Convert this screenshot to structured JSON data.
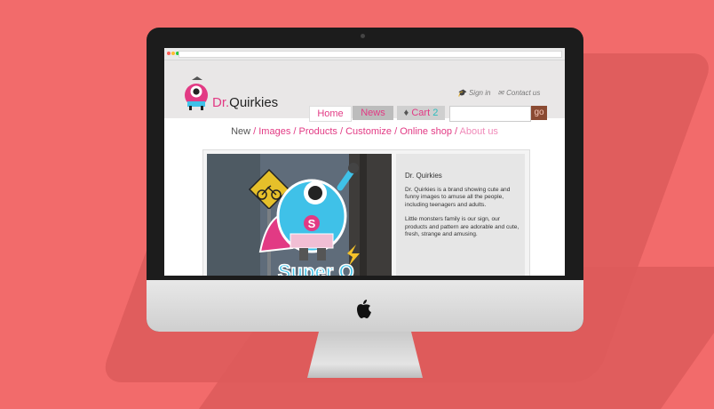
{
  "site": {
    "brand_prefix": "Dr.",
    "brand_name": "Quirkies",
    "top_links": {
      "sign_in": "Sign in",
      "contact": "Contact us"
    },
    "nav": {
      "home": "Home",
      "news": "News",
      "cart_label": "Cart",
      "cart_count": "2"
    },
    "search": {
      "placeholder": "",
      "button": "go"
    },
    "menu": [
      {
        "label": "New"
      },
      {
        "label": "Images"
      },
      {
        "label": "Products"
      },
      {
        "label": "Customize"
      },
      {
        "label": "Online shop"
      },
      {
        "label": "About us"
      }
    ],
    "feature": {
      "title": "Dr. Quirkies",
      "paragraph1": "Dr. Quirkies is a brand showing cute and funny images to amuse all the people, including teenagers and adults.",
      "paragraph2": "Little monsters family is our sign, our products and pattern are adorable and cute, fresh, strange and amusing.",
      "sticker_letter": "S",
      "sticker_caption": "Super Q"
    }
  },
  "colors": {
    "background": "#f26b6b",
    "accent": "#e23a84",
    "monster": "#3fc1e8"
  }
}
